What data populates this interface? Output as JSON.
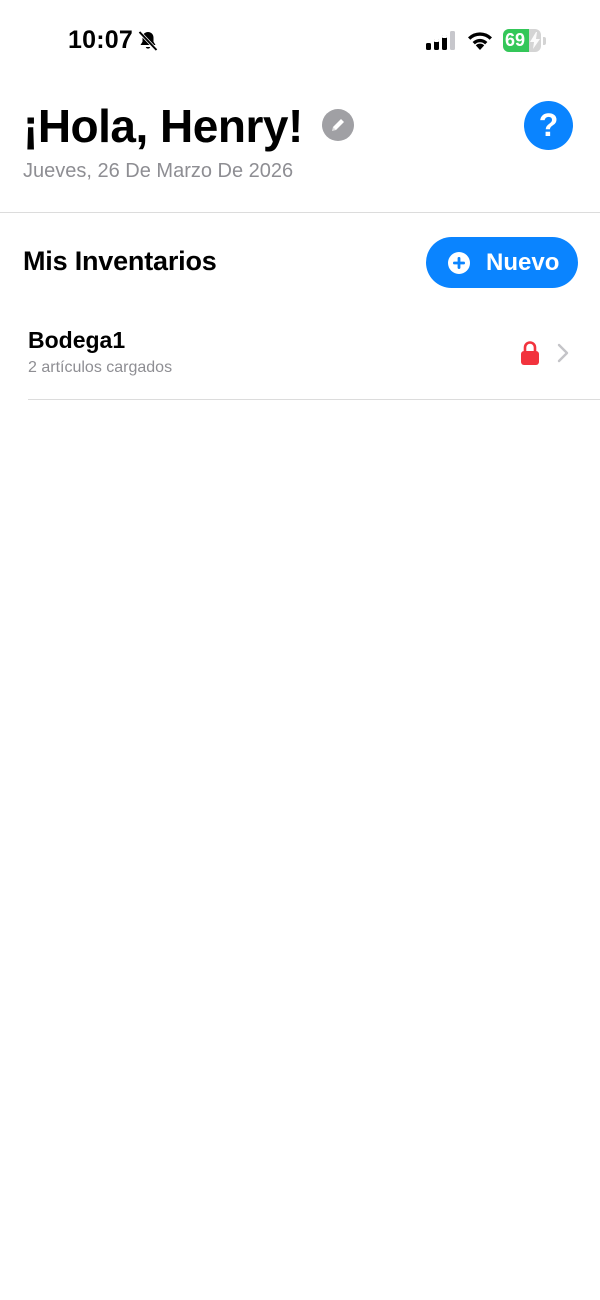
{
  "status_bar": {
    "time": "10:07",
    "battery_level": "69",
    "battery_fraction": 0.69,
    "icons": [
      "bell-slash-icon",
      "cellular-signal-icon",
      "wifi-icon",
      "battery-charging-icon"
    ]
  },
  "header": {
    "greeting": "¡Hola, Henry!",
    "date": "Jueves, 26 De Marzo De 2026",
    "edit_icon": "pencil-icon",
    "help_label": "?"
  },
  "inventories_section": {
    "title": "Mis Inventarios",
    "new_button_label": "Nuevo",
    "items": [
      {
        "name": "Bodega1",
        "subtitle": "2 artículos cargados",
        "status_icon": "lock-icon",
        "locked": true
      }
    ]
  },
  "colors": {
    "accent": "#0a84ff",
    "lock": "#f2333d",
    "battery": "#34c759",
    "secondary_text": "#8e8e93"
  }
}
